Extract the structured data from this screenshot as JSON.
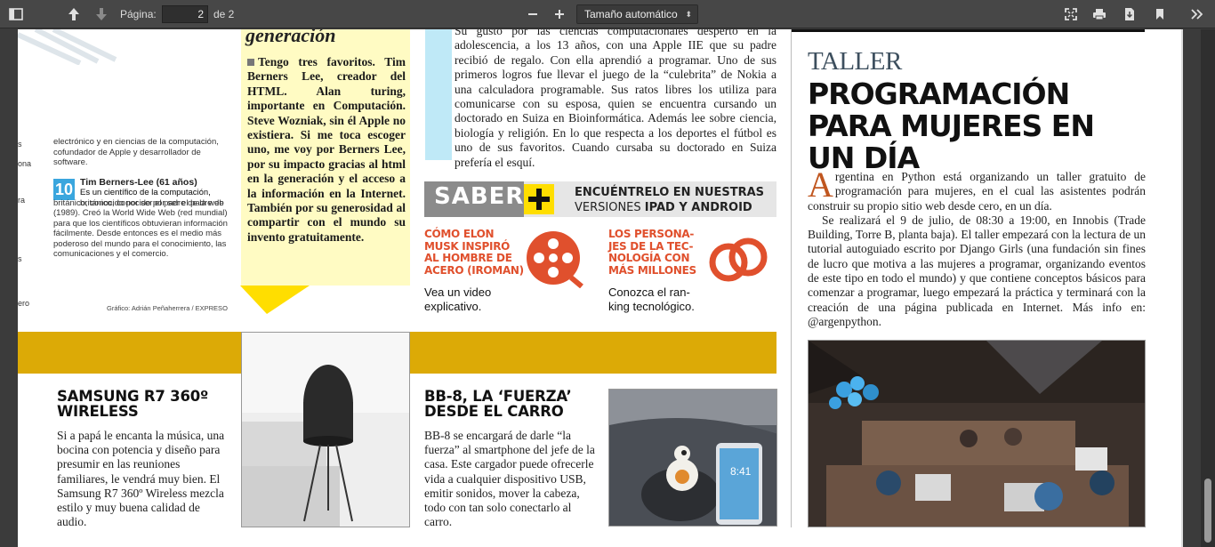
{
  "toolbar": {
    "page_label": "Página:",
    "page_value": "2",
    "page_total": "de 2",
    "zoom_value": "Tamaño automático"
  },
  "left": {
    "cut_labels": [
      "s",
      "ona",
      "ra",
      "s",
      "ero"
    ],
    "para1": "electrónico y en ciencias de la computación, cofundador de Apple y desarrollador de software.",
    "entry_number": "10",
    "entry_name": "Tim Berners-Lee (61 años)",
    "entry_text": "Es un científico de la computación, británico, conocido por ser el padre de la web (1989). Creó la World Wide Web (red mundial) para que los científicos obtuvieran información fácilmente. Desde entonces es el medio más poderoso del mundo para el conocimiento, las comunicaciones y el comercio.",
    "credit": "Gráfico: Adrián Peñaherrera / EXPRESO"
  },
  "quote": {
    "title": "generación",
    "text": "Tengo tres favoritos. Tim Berners Lee, creador del HTML. Alan turing, importante en Computación. Steve Wozniak, sin él Apple no existiera. Si me toca escoger uno, me voy por Berners Lee, por su impacto gracias al html en la generación y el acceso a la información en la Internet. También por su generosidad al compartir con el mundo su invento gratuitamente."
  },
  "middle": {
    "text": "Su gusto por las ciencias computacionales despertó en la adolescencia, a los 13 años, con una Apple IIE que su padre recibió de regalo. Con ella aprendió a programar. Uno de sus primeros logros fue llevar el juego de la “culebrita” de Nokia a una calculadora programable. Sus ratos libres los utiliza para comunicarse con su esposa, quien se encuentra cursando un doctorado en Suiza en Bioinformática. Además lee sobre ciencia, biología y religión. En lo que respecta a los deportes el fútbol es uno de sus favoritos. Cuando cursaba su doctorado en Suiza prefería el esquí."
  },
  "saber": {
    "word": "SABER",
    "line1": "ENCUÉNTRELO EN NUESTRAS",
    "line2_prefix": "VERSIONES",
    "line2_bold": "IPAD Y ANDROID",
    "promo1_title": [
      "CÓMO ELON",
      "MUSK INSPIRÓ",
      "AL HOMBRE DE",
      "ACERO (IROMAN)"
    ],
    "promo1_body": [
      "Vea un video",
      "explicativo."
    ],
    "promo2_title": [
      "LOS PERSONA-",
      "JES DE LA TEC-",
      "NOLOGÍA CON",
      "MÁS MILLONES"
    ],
    "promo2_body": [
      "Conozca el ran-",
      "king tecnológico."
    ]
  },
  "products": {
    "p1_title": [
      "SAMSUNG R7 360º",
      "WIRELESS"
    ],
    "p1_text": "Si a papá le encanta la música, una bocina con potencia y diseño para presumir en las reuniones familiares, le vendrá muy bien. El Samsung R7 360º Wireless mezcla estilo y muy buena calidad de audio.",
    "p2_title": [
      "BB-8, LA ‘FUERZA’",
      "DESDE EL CARRO"
    ],
    "p2_text": "BB-8 se encargará de darle “la fuerza” al smartphone del jefe de la casa. Este cargador puede ofrecerle vida a cualquier dispositivo USB, emitir sonidos, mover la cabeza, todo con tan solo conectarlo al carro.",
    "phone_time": "8:41"
  },
  "right": {
    "kicker": "TALLER",
    "headline": "PROGRAMACIÓN PARA MUJERES EN UN DÍA",
    "dropcap": "A",
    "p1": "rgentina en Python está organizando un taller gratuito de programación para mujeres, en el cual las asistentes podrán construir su propio sitio web desde cero, en un día.",
    "p2": "Se realizará el 9 de julio, de 08:30 a 19:00, en Innobis (Trade Building, Torre B, planta baja). El taller empezará con la lectura de un tutorial autoguiado escrito por Django Girls (una fundación sin fines de lucro que motiva a las mujeres a programar, organizando eventos de este tipo en todo el mundo) y que contiene conceptos básicos para comenzar a programar, luego empezará la práctica y terminará con la creación de una página publicada en Internet. Más info en: @argenpython."
  },
  "colors": {
    "toolbar": "#474747",
    "viewer": "#3b3b3b",
    "quote_box": "#fffbc3",
    "band": "#dcaa06",
    "promo_red": "#e0502d",
    "accent_blue": "#3aa6de",
    "saber_yellow": "#ffde00"
  },
  "icons": [
    "sidebar-toggle-icon",
    "previous-page-icon",
    "next-page-icon",
    "zoom-out-icon",
    "zoom-in-icon",
    "presentation-mode-icon",
    "print-icon",
    "download-icon",
    "bookmark-icon",
    "tools-icon",
    "film-reel-icon",
    "chain-link-icon"
  ]
}
